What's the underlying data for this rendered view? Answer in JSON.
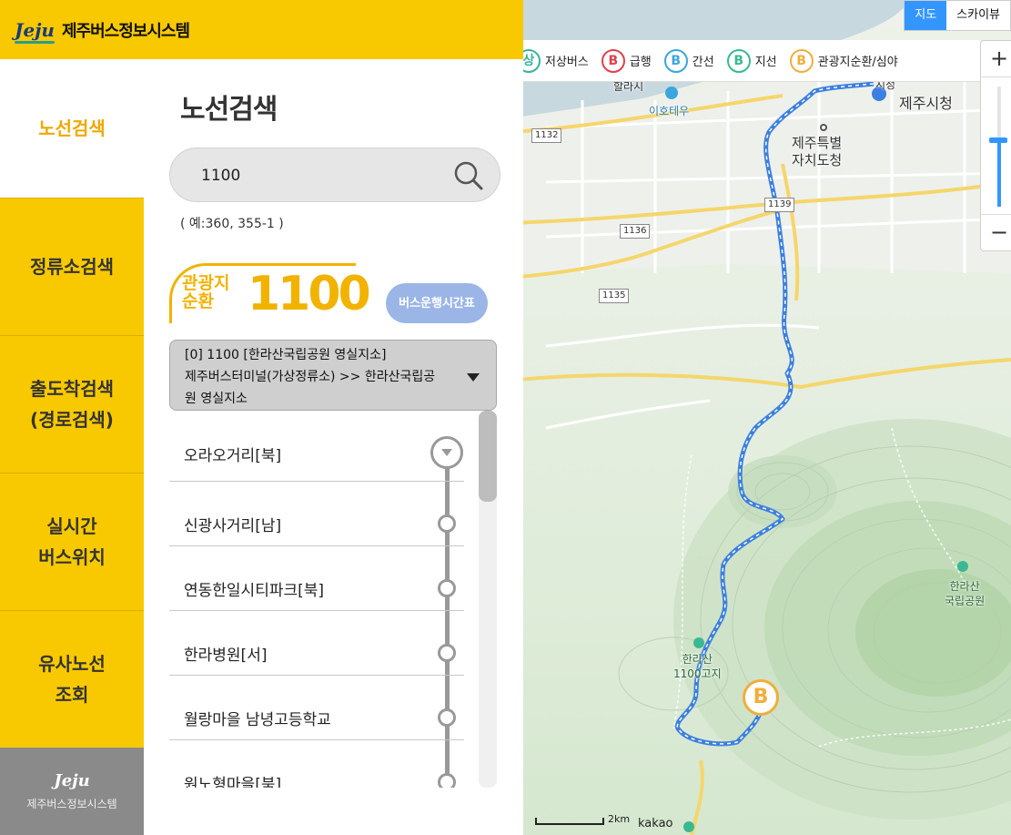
{
  "header": {
    "logo": "Jeju",
    "title": "제주버스정보시스템"
  },
  "nav": {
    "items": [
      {
        "label": "노선검색",
        "active": true
      },
      {
        "label": "정류소검색",
        "active": false
      },
      {
        "label": "출도착검색\n(경로검색)",
        "active": false
      },
      {
        "label": "실시간\n버스위치",
        "active": false
      },
      {
        "label": "유사노선\n조회",
        "active": false
      }
    ],
    "footer_logo": "Jeju",
    "footer_text": "제주버스정보시스템"
  },
  "panel": {
    "title": "노선검색",
    "search": {
      "value": "1100",
      "placeholder": ""
    },
    "example": "( 예:360, 355-1 )",
    "route": {
      "type": "관광지 순환",
      "number": "1100"
    },
    "timetable_button": "버스운행시간표",
    "route_select": {
      "line1": "[0] 1100 [한라산국립공원 영실지소]",
      "line2": "제주버스터미널(가상정류소) >> 한라산국립공",
      "line3": "원 영실지소"
    },
    "stops": [
      "오라오거리[북]",
      "신광사거리[남]",
      "연동한일시티파크[북]",
      "한라병원[서]",
      "월랑마을 남녕고등학교",
      "원노형마을[북]"
    ]
  },
  "map": {
    "type_tabs": {
      "map": "지도",
      "skyview": "스카이뷰"
    },
    "zoom_in": "+",
    "zoom_out": "−",
    "zoom_level": 0.55,
    "legend": [
      {
        "badge": "상",
        "label": "저상버스",
        "color": "#3bb0a0"
      },
      {
        "badge": "B",
        "label": "급행",
        "color": "#e0404a"
      },
      {
        "badge": "B",
        "label": "간선",
        "color": "#3aa6dd"
      },
      {
        "badge": "B",
        "label": "지선",
        "color": "#3bb893"
      },
      {
        "badge": "B",
        "label": "관광지순환/심야",
        "color": "#f0ae3a"
      }
    ],
    "labels": {
      "city_hall": "제주시청",
      "provincial_office": "제주특별\n자치도청",
      "ihotaewoo": "이호테우",
      "hallasan_park": "한라산\n국립공원",
      "highland": "한라산\n1100고지",
      "top_partial": "할라시",
      "top_partial2": "시청"
    },
    "road_numbers": [
      "1132",
      "1136",
      "1135",
      "1139"
    ],
    "scale": "2km",
    "attribution": "kakao",
    "bus_marker": "B",
    "route_color": "#3b7fe0"
  }
}
